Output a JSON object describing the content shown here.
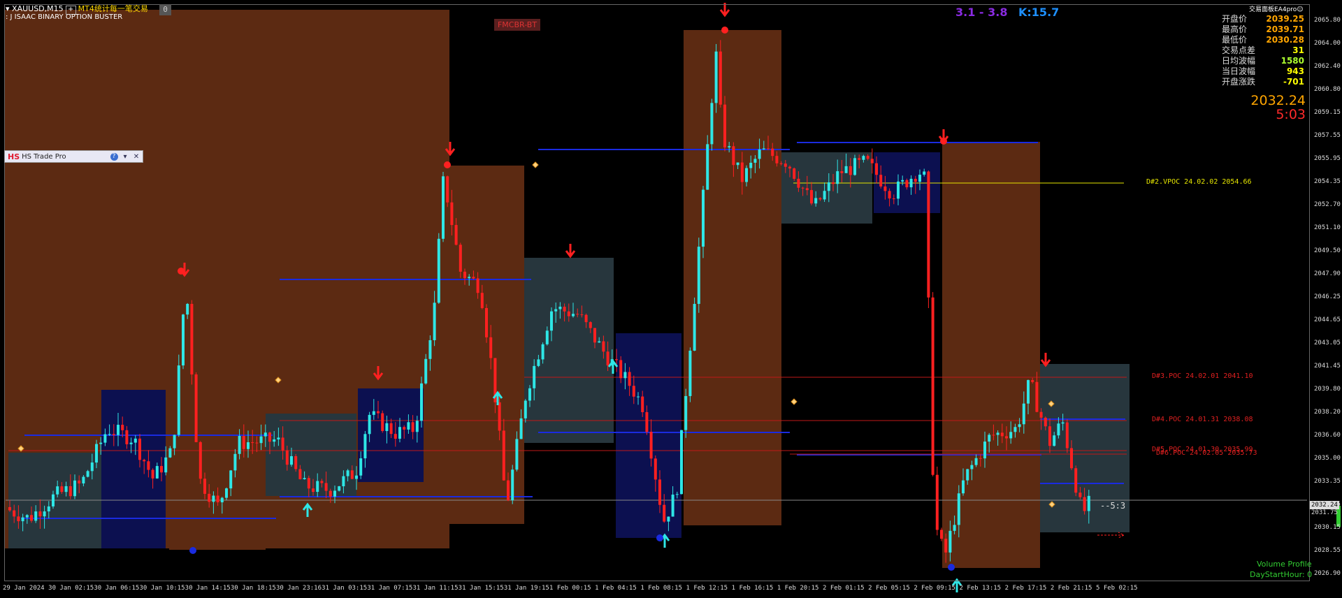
{
  "header": {
    "symbol": "XAUUSD,M15",
    "plus": "+",
    "cn_title": "MT4统计每一笔交易",
    "indicator": ": J ISAAC BINARY OPTION BUSTER",
    "badge": "0"
  },
  "fmcbr_label": "FMCBR-BT",
  "range_label": "3.1 - 3.8",
  "k_label": "K:15.7",
  "ea_title": "交易面板EA4pro",
  "stats": [
    {
      "label": "开盘价",
      "value": "2039.25",
      "color": "gold"
    },
    {
      "label": "最高价",
      "value": "2039.71",
      "color": "gold"
    },
    {
      "label": "最低价",
      "value": "2030.28",
      "color": "gold"
    },
    {
      "label": "交易点差",
      "value": "31",
      "color": "yellow"
    },
    {
      "label": "日均波幅",
      "value": "1580",
      "color": "green"
    },
    {
      "label": "当日波幅",
      "value": "943",
      "color": "yellow"
    },
    {
      "label": "开盘涨跌",
      "value": "-701",
      "color": "yellow"
    }
  ],
  "big_price": "2032.24",
  "timer": "5:03",
  "panel": {
    "logo": "HS",
    "title": "HS Trade Pro",
    "help": "?",
    "dropdown": "▾",
    "close": "✕"
  },
  "y_ticks": [
    "2065.80",
    "2064.00",
    "2062.40",
    "2060.80",
    "2059.15",
    "2057.55",
    "2055.95",
    "2054.35",
    "2052.70",
    "2051.10",
    "2049.50",
    "2047.90",
    "2046.25",
    "2044.65",
    "2043.05",
    "2041.45",
    "2039.80",
    "2038.20",
    "2036.60",
    "2035.00",
    "2033.35",
    "2031.75",
    "2030.15",
    "2028.55",
    "2026.90"
  ],
  "x_ticks": [
    "29 Jan 2024",
    "30 Jan 02:15",
    "30 Jan 06:15",
    "30 Jan 10:15",
    "30 Jan 14:15",
    "30 Jan 18:15",
    "30 Jan 23:16",
    "31 Jan 03:15",
    "31 Jan 07:15",
    "31 Jan 11:15",
    "31 Jan 15:15",
    "31 Jan 19:15",
    "1 Feb 00:15",
    "1 Feb 04:15",
    "1 Feb 08:15",
    "1 Feb 12:15",
    "1 Feb 16:15",
    "1 Feb 20:15",
    "2 Feb 01:15",
    "2 Feb 05:15",
    "2 Feb 09:15",
    "2 Feb 13:15",
    "2 Feb 17:15",
    "2 Feb 21:15",
    "5 Feb 02:15"
  ],
  "current_price_tag": "2032.24",
  "sub_price_tag": "2031.75",
  "countdown": "--5:3",
  "poc_labels": [
    {
      "text": "D#2.VPOC 24.02.02 2054.66",
      "color": "#e6e600"
    },
    {
      "text": "D#3.POC 24.02.01 2041.10",
      "color": "#e02020"
    },
    {
      "text": "D#4.POC 24.01.31 2038.08",
      "color": "#e02020"
    },
    {
      "text": "D#5.POC 24.01.30 2035.99",
      "color": "#e02020"
    },
    {
      "text": "D#6.POC 24.02.05 2035.73",
      "color": "#e02020"
    }
  ],
  "volume_profile_label": "Volume Profile",
  "day_start_label": "DayStartHour: 0",
  "colors": {
    "bull": "#2ee6e6",
    "bear": "#ff2020",
    "box_brown": "#5c2a12",
    "box_slate": "#27363d",
    "box_navy": "#0c1050",
    "level_blue": "#1a2be0",
    "poc_red": "#c01818",
    "vpoc_yellow": "#e6e600"
  },
  "chart_data": {
    "type": "candlestick",
    "symbol": "XAUUSD",
    "timeframe": "M15",
    "ylim": [
      2026.9,
      2065.8
    ],
    "last_price": 2032.24,
    "poc_levels": [
      2054.66,
      2041.1,
      2038.08,
      2035.99,
      2035.73
    ],
    "path_points": [
      {
        "t": 0.0,
        "p": 2032.0
      },
      {
        "t": 0.02,
        "p": 2031.2
      },
      {
        "t": 0.04,
        "p": 2032.8
      },
      {
        "t": 0.06,
        "p": 2033.6
      },
      {
        "t": 0.08,
        "p": 2037.5
      },
      {
        "t": 0.1,
        "p": 2036.8
      },
      {
        "t": 0.115,
        "p": 2034.0
      },
      {
        "t": 0.13,
        "p": 2036.0
      },
      {
        "t": 0.14,
        "p": 2048.0
      },
      {
        "t": 0.15,
        "p": 2034.0
      },
      {
        "t": 0.165,
        "p": 2032.0
      },
      {
        "t": 0.18,
        "p": 2036.5
      },
      {
        "t": 0.21,
        "p": 2036.7
      },
      {
        "t": 0.23,
        "p": 2033.5
      },
      {
        "t": 0.25,
        "p": 2033.2
      },
      {
        "t": 0.27,
        "p": 2034.5
      },
      {
        "t": 0.28,
        "p": 2038.5
      },
      {
        "t": 0.3,
        "p": 2037.2
      },
      {
        "t": 0.315,
        "p": 2037.5
      },
      {
        "t": 0.33,
        "p": 2046.0
      },
      {
        "t": 0.337,
        "p": 2055.2
      },
      {
        "t": 0.35,
        "p": 2048.5
      },
      {
        "t": 0.365,
        "p": 2047.5
      },
      {
        "t": 0.375,
        "p": 2041.0
      },
      {
        "t": 0.385,
        "p": 2032.0
      },
      {
        "t": 0.4,
        "p": 2040.0
      },
      {
        "t": 0.42,
        "p": 2046.0
      },
      {
        "t": 0.44,
        "p": 2045.5
      },
      {
        "t": 0.46,
        "p": 2042.8
      },
      {
        "t": 0.48,
        "p": 2040.5
      },
      {
        "t": 0.49,
        "p": 2039.0
      },
      {
        "t": 0.505,
        "p": 2031.0
      },
      {
        "t": 0.515,
        "p": 2033.0
      },
      {
        "t": 0.53,
        "p": 2048.0
      },
      {
        "t": 0.545,
        "p": 2064.0
      },
      {
        "t": 0.55,
        "p": 2058.0
      },
      {
        "t": 0.565,
        "p": 2055.0
      },
      {
        "t": 0.58,
        "p": 2057.0
      },
      {
        "t": 0.6,
        "p": 2056.2
      },
      {
        "t": 0.62,
        "p": 2053.0
      },
      {
        "t": 0.64,
        "p": 2055.5
      },
      {
        "t": 0.66,
        "p": 2056.2
      },
      {
        "t": 0.68,
        "p": 2054.0
      },
      {
        "t": 0.7,
        "p": 2055.6
      },
      {
        "t": 0.705,
        "p": 2055.0
      },
      {
        "t": 0.712,
        "p": 2031.0
      },
      {
        "t": 0.72,
        "p": 2028.5
      },
      {
        "t": 0.735,
        "p": 2034.0
      },
      {
        "t": 0.755,
        "p": 2037.0
      },
      {
        "t": 0.775,
        "p": 2037.5
      },
      {
        "t": 0.785,
        "p": 2040.8
      },
      {
        "t": 0.8,
        "p": 2036.5
      },
      {
        "t": 0.81,
        "p": 2038.0
      },
      {
        "t": 0.825,
        "p": 2031.5
      },
      {
        "t": 0.83,
        "p": 2032.2
      }
    ]
  }
}
